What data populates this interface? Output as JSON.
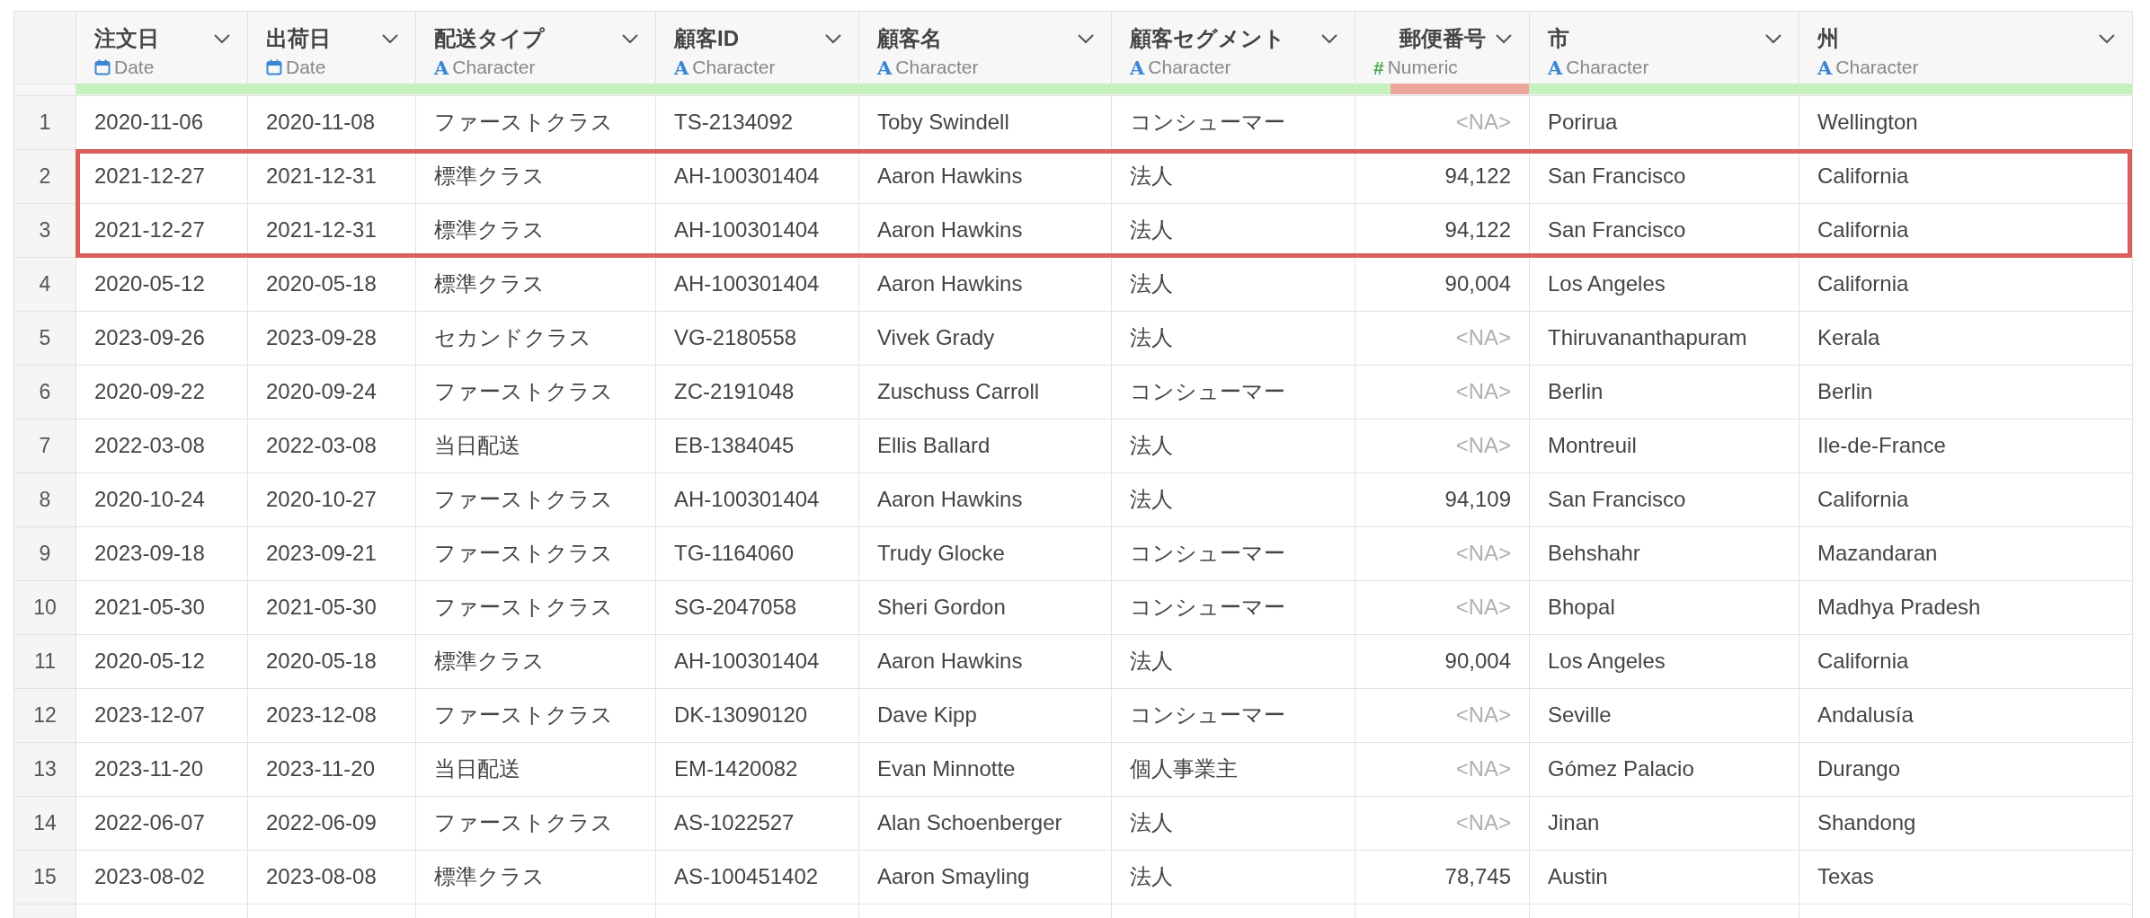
{
  "columns": [
    {
      "name": "注文日",
      "kind": "date",
      "type_label": "Date",
      "level": 1
    },
    {
      "name": "出荷日",
      "kind": "date",
      "type_label": "Date",
      "level": 1
    },
    {
      "name": "配送タイプ",
      "kind": "character",
      "type_icon": "A",
      "type_label": "Character",
      "level": 1
    },
    {
      "name": "顧客ID",
      "kind": "character",
      "type_icon": "A",
      "type_label": "Character",
      "level": 1
    },
    {
      "name": "顧客名",
      "kind": "character",
      "type_icon": "A",
      "type_label": "Character",
      "level": 1
    },
    {
      "name": "顧客セグメント",
      "kind": "character",
      "type_icon": "A",
      "type_label": "Character",
      "level": 1
    },
    {
      "name": "郵便番号",
      "kind": "numeric",
      "type_icon": "#",
      "type_label": "Numeric",
      "level": 0.2
    },
    {
      "name": "市",
      "kind": "character",
      "type_icon": "A",
      "type_label": "Character",
      "level": 1
    },
    {
      "name": "州",
      "kind": "character",
      "type_icon": "A",
      "type_label": "Character",
      "level": 1
    }
  ],
  "rows": [
    {
      "number": "1",
      "highlighted": false,
      "postal_missing": true,
      "cells": [
        "2020-11-06",
        "2020-11-08",
        "ファーストクラス",
        "TS-2134092",
        "Toby Swindell",
        "コンシューマー",
        "<NA>",
        "Porirua",
        "Wellington"
      ]
    },
    {
      "number": "2",
      "highlighted": true,
      "postal_missing": false,
      "cells": [
        "2021-12-27",
        "2021-12-31",
        "標準クラス",
        "AH-100301404",
        "Aaron Hawkins",
        "法人",
        "94,122",
        "San Francisco",
        "California"
      ]
    },
    {
      "number": "3",
      "highlighted": true,
      "postal_missing": false,
      "cells": [
        "2021-12-27",
        "2021-12-31",
        "標準クラス",
        "AH-100301404",
        "Aaron Hawkins",
        "法人",
        "94,122",
        "San Francisco",
        "California"
      ]
    },
    {
      "number": "4",
      "highlighted": false,
      "postal_missing": false,
      "cells": [
        "2020-05-12",
        "2020-05-18",
        "標準クラス",
        "AH-100301404",
        "Aaron Hawkins",
        "法人",
        "90,004",
        "Los Angeles",
        "California"
      ]
    },
    {
      "number": "5",
      "highlighted": false,
      "postal_missing": true,
      "cells": [
        "2023-09-26",
        "2023-09-28",
        "セカンドクラス",
        "VG-2180558",
        "Vivek Grady",
        "法人",
        "<NA>",
        "Thiruvananthapuram",
        "Kerala"
      ]
    },
    {
      "number": "6",
      "highlighted": false,
      "postal_missing": true,
      "cells": [
        "2020-09-22",
        "2020-09-24",
        "ファーストクラス",
        "ZC-2191048",
        "Zuschuss Carroll",
        "コンシューマー",
        "<NA>",
        "Berlin",
        "Berlin"
      ]
    },
    {
      "number": "7",
      "highlighted": false,
      "postal_missing": true,
      "cells": [
        "2022-03-08",
        "2022-03-08",
        "当日配送",
        "EB-1384045",
        "Ellis Ballard",
        "法人",
        "<NA>",
        "Montreuil",
        "Ile-de-France"
      ]
    },
    {
      "number": "8",
      "highlighted": false,
      "postal_missing": false,
      "cells": [
        "2020-10-24",
        "2020-10-27",
        "ファーストクラス",
        "AH-100301404",
        "Aaron Hawkins",
        "法人",
        "94,109",
        "San Francisco",
        "California"
      ]
    },
    {
      "number": "9",
      "highlighted": false,
      "postal_missing": true,
      "cells": [
        "2023-09-18",
        "2023-09-21",
        "ファーストクラス",
        "TG-1164060",
        "Trudy Glocke",
        "コンシューマー",
        "<NA>",
        "Behshahr",
        "Mazandaran"
      ]
    },
    {
      "number": "10",
      "highlighted": false,
      "postal_missing": true,
      "cells": [
        "2021-05-30",
        "2021-05-30",
        "ファーストクラス",
        "SG-2047058",
        "Sheri Gordon",
        "コンシューマー",
        "<NA>",
        "Bhopal",
        "Madhya Pradesh"
      ]
    },
    {
      "number": "11",
      "highlighted": false,
      "postal_missing": false,
      "cells": [
        "2020-05-12",
        "2020-05-18",
        "標準クラス",
        "AH-100301404",
        "Aaron Hawkins",
        "法人",
        "90,004",
        "Los Angeles",
        "California"
      ]
    },
    {
      "number": "12",
      "highlighted": false,
      "postal_missing": true,
      "cells": [
        "2023-12-07",
        "2023-12-08",
        "ファーストクラス",
        "DK-13090120",
        "Dave Kipp",
        "コンシューマー",
        "<NA>",
        "Seville",
        "Andalusía"
      ]
    },
    {
      "number": "13",
      "highlighted": false,
      "postal_missing": true,
      "cells": [
        "2023-11-20",
        "2023-11-20",
        "当日配送",
        "EM-1420082",
        "Evan Minnotte",
        "個人事業主",
        "<NA>",
        "Gómez Palacio",
        "Durango"
      ]
    },
    {
      "number": "14",
      "highlighted": false,
      "postal_missing": true,
      "cells": [
        "2022-06-07",
        "2022-06-09",
        "ファーストクラス",
        "AS-1022527",
        "Alan Schoenberger",
        "法人",
        "<NA>",
        "Jinan",
        "Shandong"
      ]
    },
    {
      "number": "15",
      "highlighted": false,
      "postal_missing": false,
      "cells": [
        "2023-08-02",
        "2023-08-08",
        "標準クラス",
        "AS-100451402",
        "Aaron Smayling",
        "法人",
        "78,745",
        "Austin",
        "Texas"
      ]
    }
  ]
}
